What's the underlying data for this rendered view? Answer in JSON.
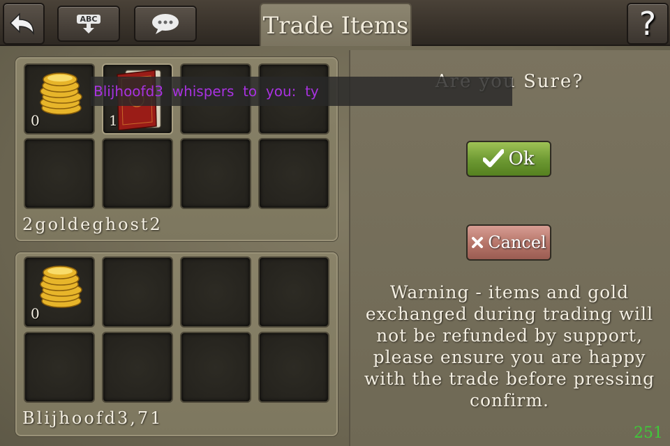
{
  "topbar": {
    "back_icon": "back-arrow-icon",
    "keyboard_icon": "abc-keyboard-icon",
    "keyboard_icon_label": "ABC",
    "chat_icon": "chat-bubble-icon",
    "tab_title": "Trade Items",
    "help_icon": "question-mark-icon"
  },
  "my_panel": {
    "player_name": "2goldeghost2",
    "slots": [
      {
        "item": "gold-coins",
        "qty": "0"
      },
      {
        "item": "red-book",
        "qty": "1"
      }
    ]
  },
  "other_panel": {
    "player_name": "Blijhoofd3,71",
    "slots": [
      {
        "item": "gold-coins",
        "qty": "0"
      }
    ]
  },
  "dialog": {
    "question": "Are you Sure?",
    "ok_label": "Ok",
    "cancel_label": "Cancel",
    "warning": "Warning - items and gold exchanged during trading will not be refunded by support, please ensure you are happy with the trade before pressing confirm."
  },
  "chat": {
    "whisper": "Blijhoofd3  whispers  to  you:  ty"
  },
  "status": {
    "counter": "251"
  },
  "colors": {
    "whisper_text": "#a832e0",
    "counter_text": "#3fc93a",
    "ok_button": "#6c9832",
    "cancel_button": "#b57468"
  }
}
